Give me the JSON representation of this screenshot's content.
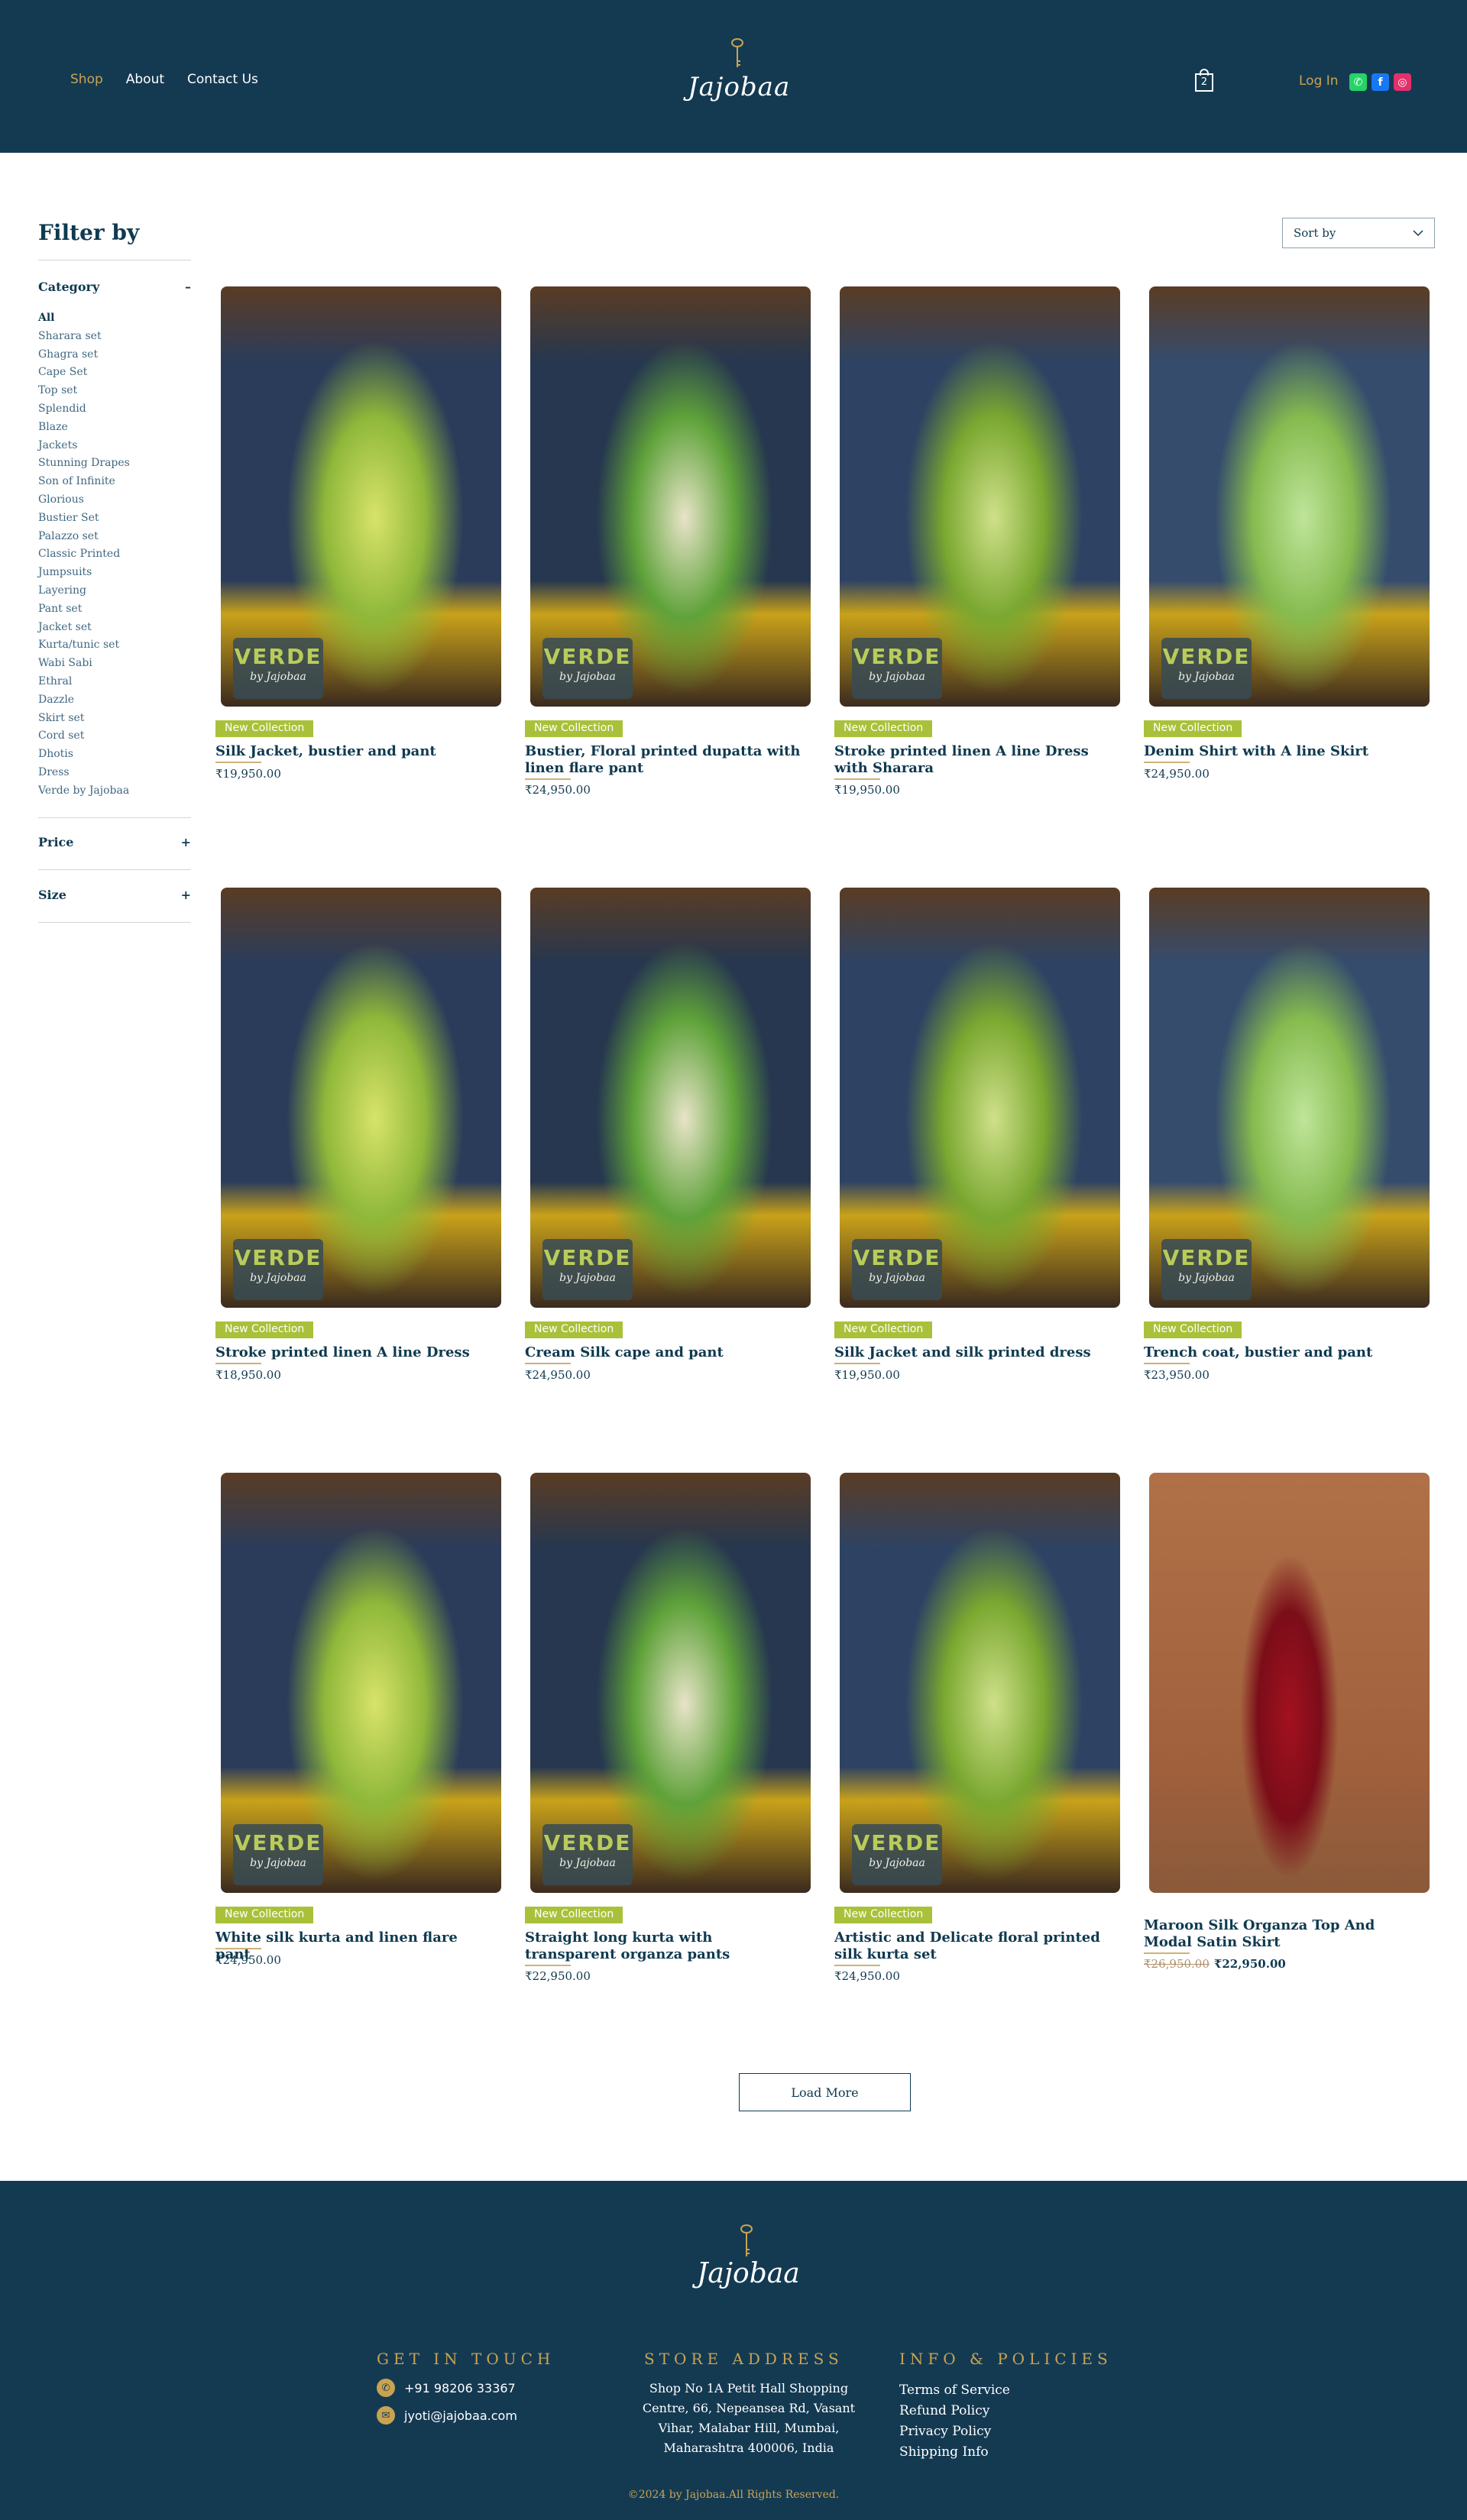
{
  "header": {
    "nav": [
      "Shop",
      "About",
      "Contact Us"
    ],
    "brand": "Jajobaa",
    "cart_count": "2",
    "login_label": "Log In",
    "socials": [
      "whatsapp-icon",
      "facebook-icon",
      "instagram-icon"
    ]
  },
  "sidebar": {
    "title": "Filter by",
    "category_label": "Category",
    "category_toggle": "–",
    "categories": [
      "All",
      "Sharara set",
      "Ghagra set",
      "Cape Set",
      "Top set",
      "Splendid",
      "Blaze",
      "Jackets",
      "Stunning Drapes",
      "Son of Infinite",
      "Glorious",
      "Bustier Set",
      "Palazzo set",
      "Classic Printed",
      "Jumpsuits",
      "Layering",
      "Pant set",
      "Jacket set",
      "Kurta/tunic set",
      "Wabi Sabi",
      "Ethral",
      "Dazzle",
      "Skirt set",
      "Cord set",
      "Dhotis",
      "Dress",
      "Verde by Jajobaa"
    ],
    "price_label": "Price",
    "size_label": "Size",
    "expand_symbol": "+"
  },
  "sort": {
    "label": "Sort by"
  },
  "badge_text": "New Collection",
  "watermark": {
    "title": "VERDE",
    "subtitle": "by Jajobaa"
  },
  "products": [
    {
      "name": "Silk Jacket, bustier and pant",
      "price": "₹19,950.00",
      "badge": true,
      "watermark": true
    },
    {
      "name": "Bustier, Floral printed dupatta with linen flare pant",
      "price": "₹24,950.00",
      "badge": true,
      "watermark": true
    },
    {
      "name": "Stroke printed linen A line Dress with Sharara",
      "price": "₹19,950.00",
      "badge": true,
      "watermark": true
    },
    {
      "name": "Denim Shirt with A line Skirt",
      "price": "₹24,950.00",
      "badge": true,
      "watermark": true
    },
    {
      "name": "Stroke printed linen A line Dress",
      "price": "₹18,950.00",
      "badge": true,
      "watermark": true
    },
    {
      "name": "Cream Silk cape and pant",
      "price": "₹24,950.00",
      "badge": true,
      "watermark": true
    },
    {
      "name": "Silk Jacket and silk printed dress",
      "price": "₹19,950.00",
      "badge": true,
      "watermark": true
    },
    {
      "name": "Trench coat, bustier and pant",
      "price": "₹23,950.00",
      "badge": true,
      "watermark": true
    },
    {
      "name": "White silk kurta and linen flare pant",
      "price": "₹24,950.00",
      "badge": true,
      "watermark": true
    },
    {
      "name": "Straight long kurta with transparent organza pants",
      "price": "₹22,950.00",
      "badge": true,
      "watermark": true
    },
    {
      "name": "Artistic and Delicate floral printed silk kurta set",
      "price": "₹24,950.00",
      "badge": true,
      "watermark": true
    },
    {
      "name": "Maroon Silk Organza Top And Modal Satin Skirt",
      "price_old": "₹26,950.00",
      "price": "₹22,950.00",
      "badge": false,
      "watermark": false
    }
  ],
  "load_more": "Load More",
  "footer": {
    "brand": "Jajobaa",
    "get_in_touch": "GET IN TOUCH",
    "phone": "+91 98206 33367",
    "email": "jyoti@jajobaa.com",
    "store_heading": "STORE ADDRESS",
    "address": "Shop No 1A Petit Hall Shopping Centre, 66, Nepeansea Rd, Vasant Vihar, Malabar Hill, Mumbai, Maharashtra 400006, India",
    "info_heading": "INFO & POLICIES",
    "links": [
      "Terms of Service",
      "Refund Policy",
      "Privacy Policy",
      "Shipping Info"
    ],
    "copyright": "©2024 by Jajobaa.All Rights Reserved."
  },
  "colors": {
    "navy": "#143a52",
    "gold": "#c9a352",
    "lime": "#a9c13a"
  }
}
